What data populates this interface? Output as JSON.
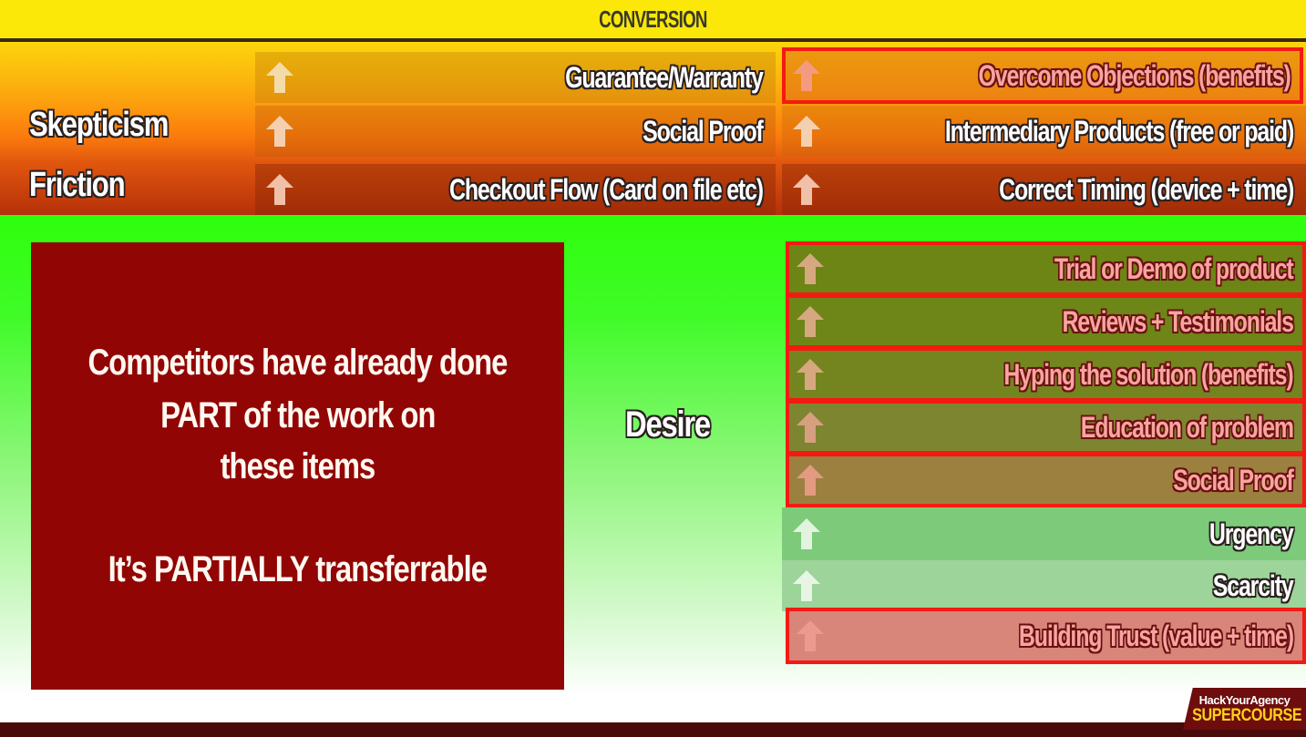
{
  "header": {
    "title": "CONVERSION"
  },
  "colors": {
    "header_bg": "#fce808",
    "highlight_border": "#f41a12",
    "left_box_bg": "#920505",
    "green": "#2eff0c",
    "orange": "#fb7a0d"
  },
  "top_section": {
    "categories": [
      {
        "label": "Skepticism"
      },
      {
        "label": "Friction"
      }
    ],
    "left_column": [
      {
        "label": "Guarantee/Warranty",
        "icon": "arrow-up-icon",
        "highlighted": false
      },
      {
        "label": "Social Proof",
        "icon": "arrow-up-icon",
        "highlighted": false
      },
      {
        "label": "Checkout Flow (Card on file etc)",
        "icon": "arrow-up-icon",
        "highlighted": false
      }
    ],
    "right_column": [
      {
        "label": "Overcome Objections (benefits)",
        "icon": "arrow-up-icon",
        "highlighted": true
      },
      {
        "label": "Intermediary Products (free or paid)",
        "icon": "arrow-up-icon",
        "highlighted": false
      },
      {
        "label": "Correct Timing (device + time)",
        "icon": "arrow-up-icon",
        "highlighted": false
      }
    ]
  },
  "desire_section": {
    "category": "Desire",
    "items": [
      {
        "label": "Trial or Demo of product",
        "icon": "arrow-up-icon",
        "highlighted": true
      },
      {
        "label": "Reviews + Testimonials",
        "icon": "arrow-up-icon",
        "highlighted": true
      },
      {
        "label": "Hyping the solution (benefits)",
        "icon": "arrow-up-icon",
        "highlighted": true
      },
      {
        "label": "Education of problem",
        "icon": "arrow-up-icon",
        "highlighted": true
      },
      {
        "label": "Social Proof",
        "icon": "arrow-up-icon",
        "highlighted": true
      },
      {
        "label": "Urgency",
        "icon": "arrow-up-icon",
        "highlighted": false
      },
      {
        "label": "Scarcity",
        "icon": "arrow-up-icon",
        "highlighted": false
      },
      {
        "label": "Building Trust (value + time)",
        "icon": "arrow-up-icon",
        "highlighted": true
      }
    ]
  },
  "callout": {
    "lines": [
      "Competitors have already done",
      "PART of the work on",
      "these items",
      "It’s PARTIALLY transferrable"
    ]
  },
  "brand": {
    "name": "HackYourAgency",
    "product": "SUPERCOURSE"
  }
}
